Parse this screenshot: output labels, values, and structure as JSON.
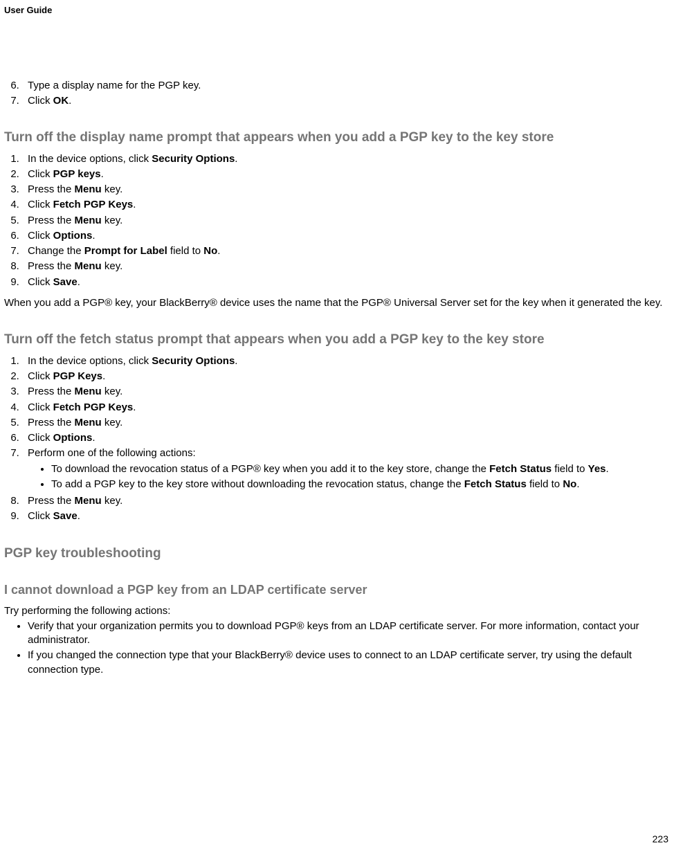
{
  "header": {
    "title": "User Guide"
  },
  "footer": {
    "page_number": "223"
  },
  "intro_steps_start": 6,
  "intro_steps": [
    {
      "text": "Type a display name for the PGP key."
    },
    {
      "prefix": "Click ",
      "bold": "OK",
      "suffix": "."
    }
  ],
  "section1": {
    "heading": "Turn off the display name prompt that appears when you add a PGP key to the key store",
    "steps": [
      {
        "prefix": "In the device options, click ",
        "bold": "Security Options",
        "suffix": "."
      },
      {
        "prefix": "Click ",
        "bold": "PGP keys",
        "suffix": "."
      },
      {
        "prefix": "Press the ",
        "bold": "Menu",
        "suffix": " key."
      },
      {
        "prefix": "Click ",
        "bold": "Fetch PGP Keys",
        "suffix": "."
      },
      {
        "prefix": "Press the ",
        "bold": "Menu",
        "suffix": " key."
      },
      {
        "prefix": "Click ",
        "bold": "Options",
        "suffix": "."
      },
      {
        "prefix": "Change the ",
        "bold": "Prompt for Label",
        "suffix_prefix": " field to ",
        "bold2": "No",
        "suffix2": "."
      },
      {
        "prefix": "Press the ",
        "bold": "Menu",
        "suffix": " key."
      },
      {
        "prefix": "Click ",
        "bold": "Save",
        "suffix": "."
      }
    ],
    "trailing": "When you add a PGP® key, your BlackBerry® device uses the name that the PGP® Universal Server set for the key when it generated the key."
  },
  "section2": {
    "heading": "Turn off the fetch status prompt that appears when you add a PGP key to the key store",
    "steps_part1": [
      {
        "prefix": "In the device options, click ",
        "bold": "Security Options",
        "suffix": "."
      },
      {
        "prefix": "Click ",
        "bold": "PGP Keys",
        "suffix": "."
      },
      {
        "prefix": "Press the ",
        "bold": "Menu",
        "suffix": " key."
      },
      {
        "prefix": "Click ",
        "bold": "Fetch PGP Keys",
        "suffix": "."
      },
      {
        "prefix": "Press the ",
        "bold": "Menu",
        "suffix": " key."
      },
      {
        "prefix": "Click ",
        "bold": "Options",
        "suffix": "."
      },
      {
        "text": "Perform one of the following actions:"
      }
    ],
    "sub_bullets": [
      {
        "prefix": "To download the revocation status of a PGP® key when you add it to the key store, change the ",
        "bold": "Fetch Status",
        "suffix_prefix": " field to ",
        "bold2": "Yes",
        "suffix2": "."
      },
      {
        "prefix": "To add a PGP key to the key store without downloading the revocation status, change the ",
        "bold": "Fetch Status",
        "suffix_prefix": " field to ",
        "bold2": "No",
        "suffix2": "."
      }
    ],
    "steps_part2_start": 8,
    "steps_part2": [
      {
        "prefix": "Press the ",
        "bold": "Menu",
        "suffix": " key."
      },
      {
        "prefix": "Click ",
        "bold": "Save",
        "suffix": "."
      }
    ]
  },
  "section3": {
    "heading": "PGP key troubleshooting",
    "sub_heading": "I cannot download a PGP key from an LDAP certificate server",
    "intro": "Try performing the following actions:",
    "bullets": [
      {
        "text": "Verify that your organization permits you to download PGP® keys from an LDAP certificate server. For more information, contact your administrator."
      },
      {
        "text": "If you changed the connection type that your BlackBerry® device uses to connect to an LDAP certificate server, try using the default connection type."
      }
    ]
  }
}
